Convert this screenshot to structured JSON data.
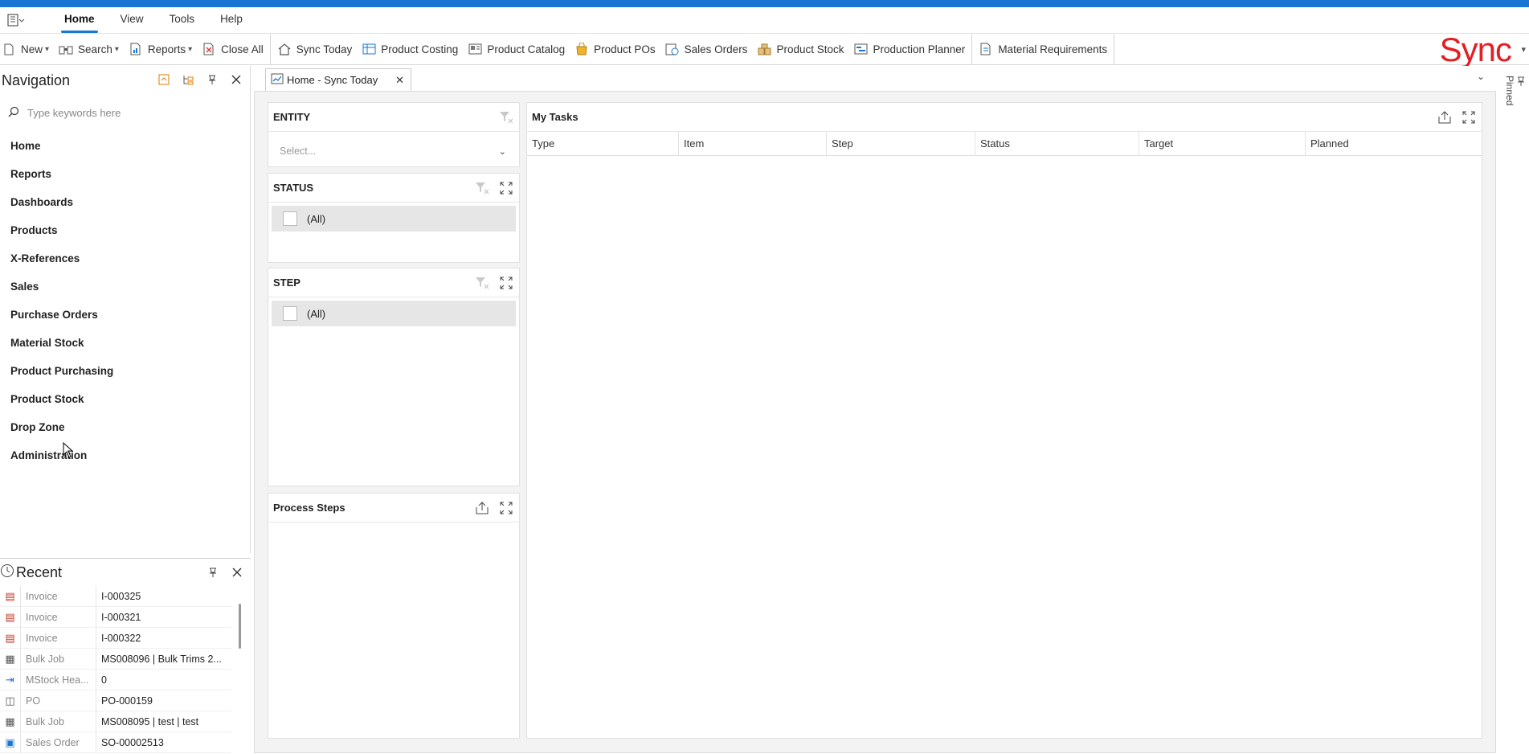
{
  "menubar": {
    "items": [
      "Home",
      "View",
      "Tools",
      "Help"
    ]
  },
  "toolbar": {
    "new": "New",
    "search": "Search",
    "reports": "Reports",
    "close_all": "Close All",
    "sync_today": "Sync Today",
    "product_costing": "Product Costing",
    "product_catalog": "Product Catalog",
    "product_pos": "Product POs",
    "sales_orders": "Sales Orders",
    "product_stock": "Product Stock",
    "production_planner": "Production Planner",
    "material_requirements": "Material Requirements",
    "brand": "Sync",
    "brand_color": "#e31e24"
  },
  "navigation": {
    "title": "Navigation",
    "search_placeholder": "Type keywords here",
    "items": [
      "Home",
      "Reports",
      "Dashboards",
      "Products",
      "X-References",
      "Sales",
      "Purchase Orders",
      "Material Stock",
      "Product Purchasing",
      "Product Stock",
      "Drop Zone",
      "Administration"
    ]
  },
  "recent": {
    "title": "Recent",
    "rows": [
      {
        "type": "Invoice",
        "value": "I-000325",
        "icon": "invoice-icon"
      },
      {
        "type": "Invoice",
        "value": "I-000321",
        "icon": "invoice-icon"
      },
      {
        "type": "Invoice",
        "value": "I-000322",
        "icon": "invoice-icon"
      },
      {
        "type": "Bulk Job",
        "value": "MS008096 | Bulk Trims 2...",
        "icon": "bulk-job-icon"
      },
      {
        "type": "MStock Hea...",
        "value": "0",
        "icon": "mstock-icon"
      },
      {
        "type": "PO",
        "value": "PO-000159",
        "icon": "po-icon"
      },
      {
        "type": "Bulk Job",
        "value": "MS008095 | test | test",
        "icon": "bulk-job-icon"
      },
      {
        "type": "Sales Order",
        "value": "SO-00002513",
        "icon": "sales-order-icon"
      }
    ]
  },
  "main": {
    "tab_label": "Home - Sync Today",
    "pinned_label": "Pinned",
    "entity": {
      "title": "ENTITY",
      "placeholder": "Select..."
    },
    "status": {
      "title": "STATUS",
      "option": "(All)"
    },
    "step": {
      "title": "STEP",
      "option": "(All)"
    },
    "process_steps": {
      "title": "Process Steps"
    },
    "my_tasks": {
      "title": "My Tasks",
      "columns": [
        "Type",
        "Item",
        "Step",
        "Status",
        "Target",
        "Planned"
      ]
    }
  },
  "colors": {
    "accent": "#1976d2",
    "brand": "#e31e24"
  }
}
